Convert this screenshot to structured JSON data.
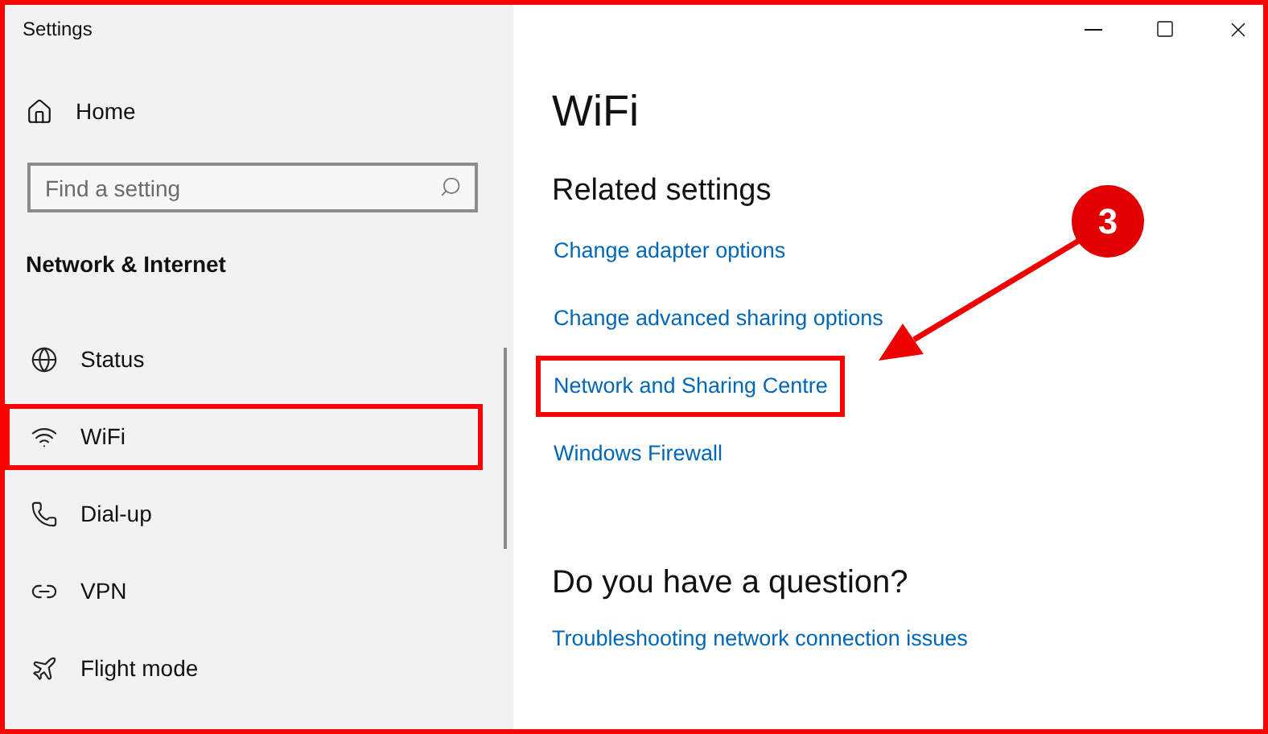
{
  "window": {
    "title": "Settings"
  },
  "sidebar": {
    "home": "Home",
    "search": {
      "placeholder": "Find a setting"
    },
    "section": "Network & Internet",
    "items": [
      {
        "label": "Status",
        "kind": "status",
        "annotated": false
      },
      {
        "label": "WiFi",
        "kind": "wifi",
        "annotated": true
      },
      {
        "label": "Dial-up",
        "kind": "dialup",
        "annotated": false
      },
      {
        "label": "VPN",
        "kind": "vpn",
        "annotated": false
      },
      {
        "label": "Flight mode",
        "kind": "flight",
        "annotated": false
      }
    ]
  },
  "main": {
    "title": "WiFi",
    "related_heading": "Related settings",
    "links": [
      {
        "label": "Change adapter options",
        "annotated": false
      },
      {
        "label": "Change advanced sharing options",
        "annotated": false
      },
      {
        "label": "Network and Sharing Centre",
        "annotated": true
      },
      {
        "label": "Windows Firewall",
        "annotated": false
      }
    ],
    "question_heading": "Do you have a question?",
    "question_links": [
      {
        "label": "Troubleshooting network connection issues"
      }
    ]
  },
  "annotation": {
    "step": "3"
  }
}
